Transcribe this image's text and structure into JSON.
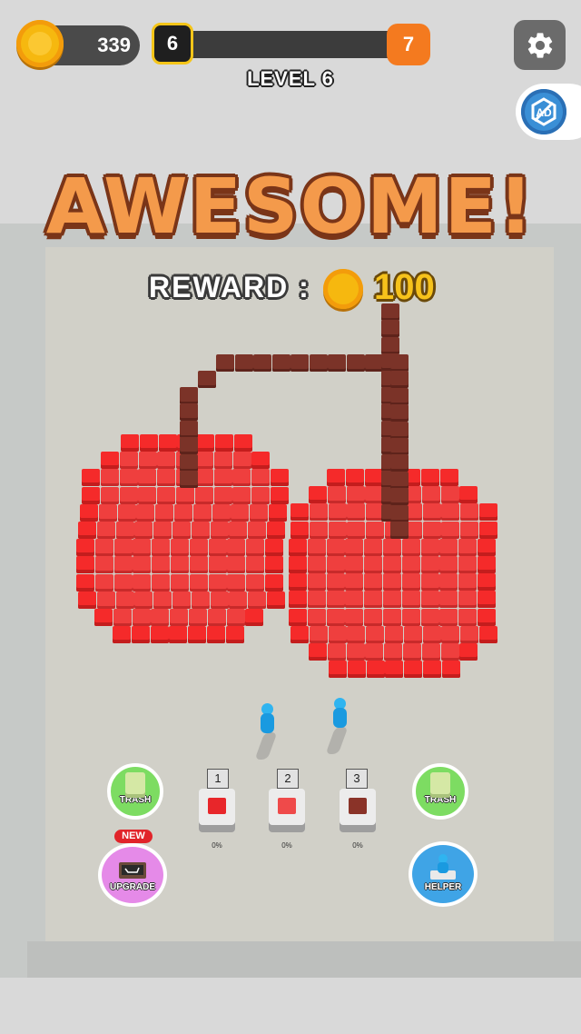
{
  "hud": {
    "coins": "339",
    "current_level": "6",
    "next_level": "7",
    "level_label": "LEVEL 6",
    "level_progress": 0
  },
  "icons": {
    "settings": "gear-icon",
    "no_ads": "no-ads-icon",
    "coin": "coin-icon"
  },
  "result": {
    "title": "AWESOME!",
    "reward_label": "REWARD :",
    "reward_value": "100"
  },
  "artwork": {
    "subject": "cherries",
    "colors": {
      "red": "#ef3f3e",
      "red_edge": "#f52a2a",
      "stem": "#7b3328"
    }
  },
  "buttons": {
    "trash_left": "TRASH",
    "trash_right": "TRASH",
    "upgrade": "UPGRADE",
    "upgrade_badge": "NEW",
    "helper": "HELPER"
  },
  "stations": [
    {
      "number": "1",
      "percent": "0%",
      "color": "#e8262a"
    },
    {
      "number": "2",
      "percent": "0%",
      "color": "#ef4a4a"
    },
    {
      "number": "3",
      "percent": "0%",
      "color": "#8a3328"
    }
  ]
}
